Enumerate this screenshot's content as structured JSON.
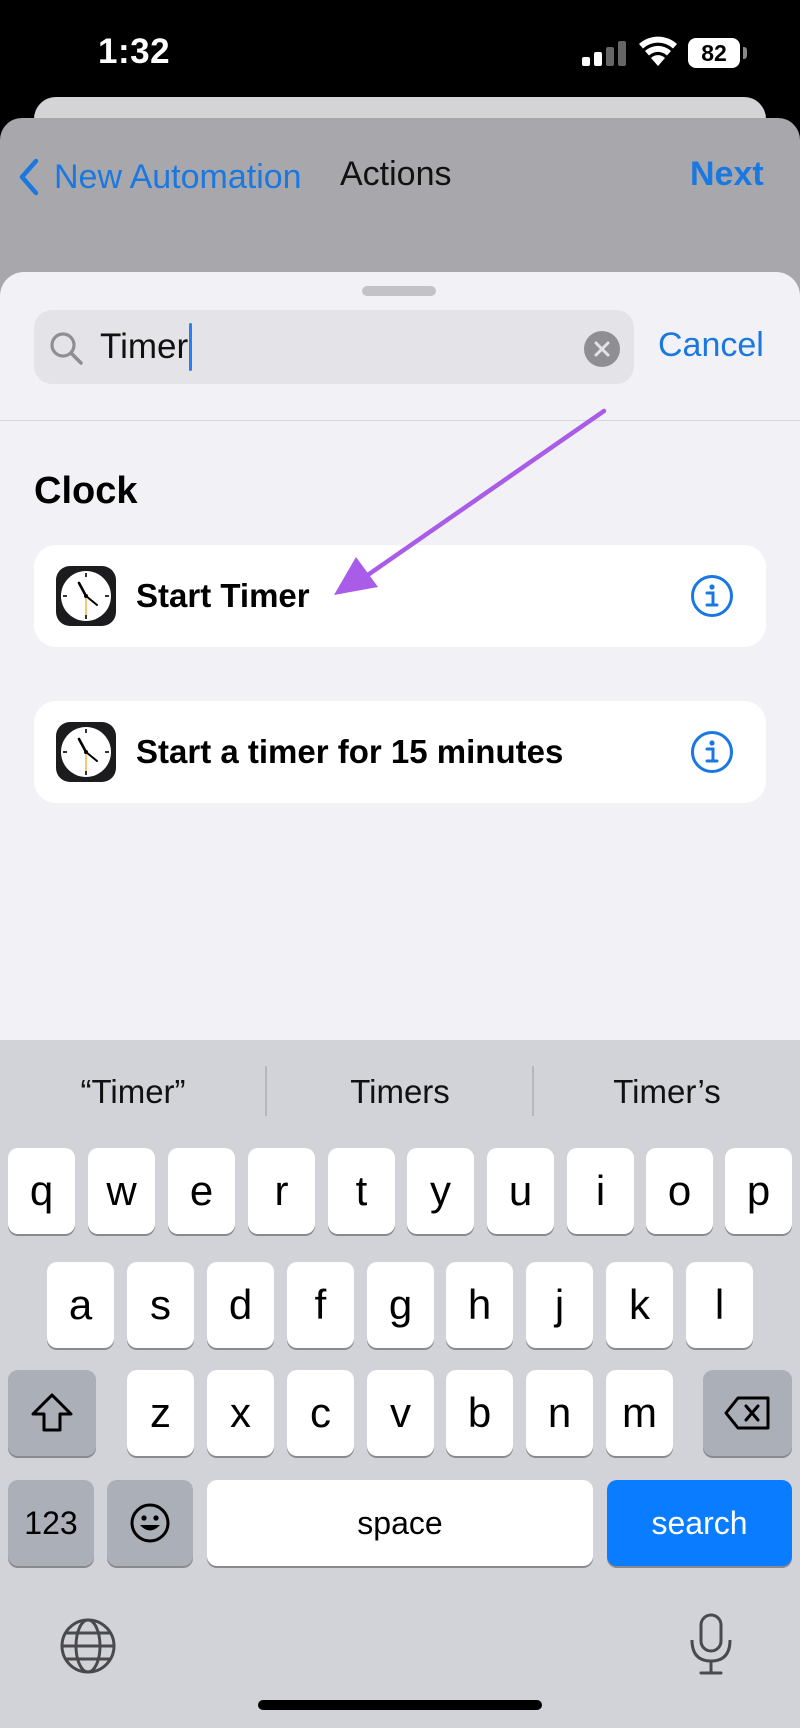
{
  "status_bar": {
    "time": "1:32",
    "battery": "82"
  },
  "nav": {
    "back_label": "New Automation",
    "title": "Actions",
    "next_label": "Next"
  },
  "search": {
    "value": "Timer",
    "cancel_label": "Cancel"
  },
  "section": {
    "title": "Clock"
  },
  "results": [
    {
      "label": "Start Timer",
      "icon": "clock-app-icon"
    },
    {
      "label": "Start a timer for 15 minutes",
      "icon": "clock-app-icon"
    }
  ],
  "keyboard": {
    "suggestions": [
      "“Timer”",
      "Timers",
      "Timer’s"
    ],
    "row1": [
      "q",
      "w",
      "e",
      "r",
      "t",
      "y",
      "u",
      "i",
      "o",
      "p"
    ],
    "row2": [
      "a",
      "s",
      "d",
      "f",
      "g",
      "h",
      "j",
      "k",
      "l"
    ],
    "row3": [
      "z",
      "x",
      "c",
      "v",
      "b",
      "n",
      "m"
    ],
    "numbers_label": "123",
    "space_label": "space",
    "search_label": "search"
  },
  "colors": {
    "accent": "#1a78e0",
    "search_key": "#0a7cff",
    "arrow": "#a95ce8"
  }
}
